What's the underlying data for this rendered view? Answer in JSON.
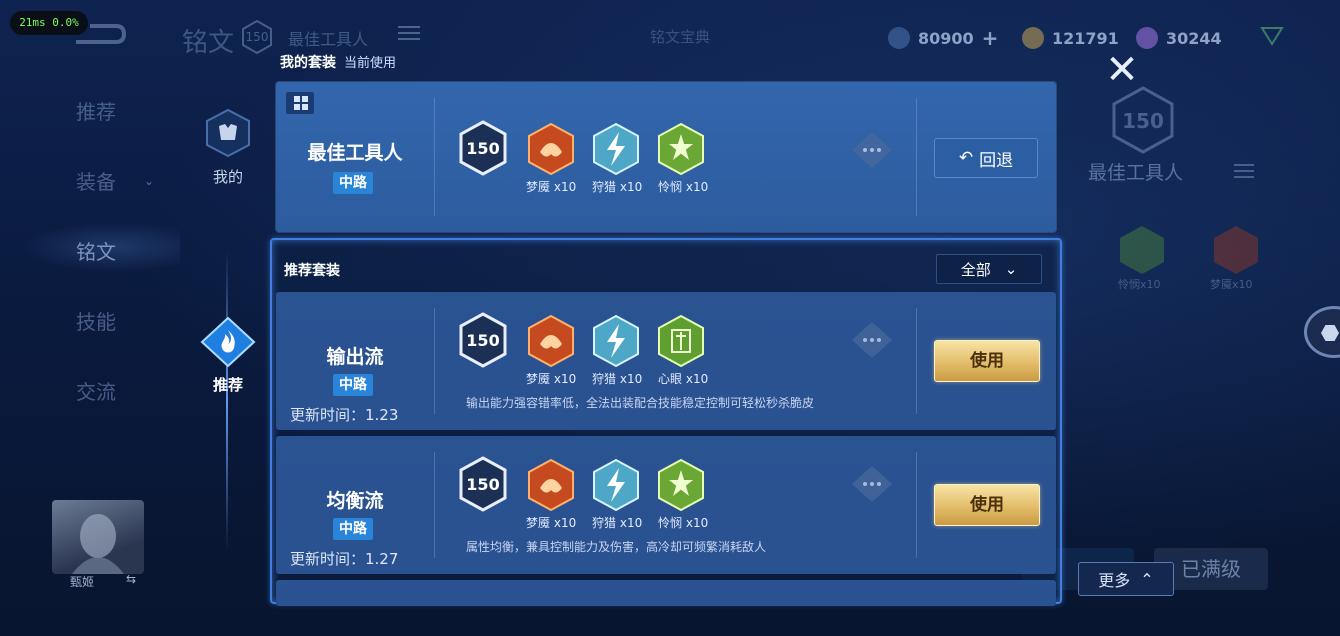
{
  "perf": "21ms 0.0%",
  "header": {
    "title": "铭文",
    "level": "150",
    "set_name": "最佳工具人",
    "rune_system": "铭文宝典",
    "currencies": [
      {
        "icon": "coupon-icon",
        "value": "80900"
      },
      {
        "icon": "gold-coin-icon",
        "value": "121791"
      },
      {
        "icon": "gem-icon",
        "value": "30244"
      }
    ]
  },
  "leftnav": {
    "items": [
      {
        "label": "推荐"
      },
      {
        "label": "装备"
      },
      {
        "label": "铭文"
      },
      {
        "label": "技能"
      },
      {
        "label": "交流"
      }
    ]
  },
  "rail": {
    "mine": "我的",
    "recommend": "推荐"
  },
  "hero": {
    "name": "甄姬"
  },
  "background_panel": {
    "level": "150",
    "set_name": "最佳工具人",
    "runes": [
      {
        "label": "怜悯x10"
      },
      {
        "label": "梦魇x10"
      }
    ],
    "maxed_label": "已满级",
    "more_label": "更多"
  },
  "popup": {
    "mine_heading": "我的套装",
    "current_label": "当前使用",
    "current": {
      "name": "最佳工具人",
      "role": "中路",
      "level": "150",
      "runes": [
        {
          "name": "梦魇",
          "count": "x10",
          "color": "red"
        },
        {
          "name": "狩猎",
          "count": "x10",
          "color": "blue"
        },
        {
          "name": "怜悯",
          "count": "x10",
          "color": "green"
        }
      ],
      "revert_label": "回退"
    },
    "rec_heading": "推荐套装",
    "filter_label": "全部",
    "recommended": [
      {
        "name": "输出流",
        "role": "中路",
        "updated": "更新时间：1.23",
        "level": "150",
        "runes": [
          {
            "name": "梦魇",
            "count": "x10",
            "color": "red"
          },
          {
            "name": "狩猎",
            "count": "x10",
            "color": "blue"
          },
          {
            "name": "心眼",
            "count": "x10",
            "color": "green"
          }
        ],
        "description": "输出能力强容错率低，全法出装配合技能稳定控制可轻松秒杀脆皮",
        "use_label": "使用"
      },
      {
        "name": "均衡流",
        "role": "中路",
        "updated": "更新时间：1.27",
        "level": "150",
        "runes": [
          {
            "name": "梦魇",
            "count": "x10",
            "color": "red"
          },
          {
            "name": "狩猎",
            "count": "x10",
            "color": "blue"
          },
          {
            "name": "怜悯",
            "count": "x10",
            "color": "green"
          }
        ],
        "description": "属性均衡，兼具控制能力及伤害，高冷却可频繁消耗敌人",
        "use_label": "使用"
      }
    ]
  },
  "colors": {
    "accent_blue": "#2a84d8",
    "gold_button": "#e3bd6a",
    "card_bg": "#2a5190"
  }
}
